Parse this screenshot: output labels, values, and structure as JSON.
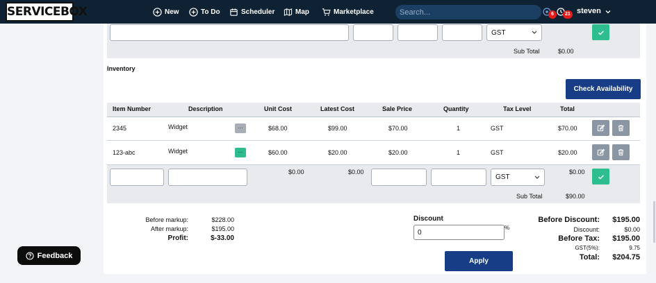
{
  "header": {
    "logo_text": "SERVICEBOX",
    "nav": [
      {
        "label": "New",
        "icon": "plus-circle-icon"
      },
      {
        "label": "To Do",
        "icon": "plus-circle-icon"
      },
      {
        "label": "Scheduler",
        "icon": "calendar-icon"
      },
      {
        "label": "Map",
        "icon": "map-icon"
      },
      {
        "label": "Marketplace",
        "icon": "cart-icon"
      }
    ],
    "search_placeholder": "Search...",
    "notification_badge": "6",
    "clock_badge": "21",
    "username": "steven"
  },
  "top_section": {
    "tax_selected": "GST",
    "subtotal_label": "Sub Total",
    "subtotal_value": "$0.00"
  },
  "inventory": {
    "title": "Inventory",
    "check_availability_label": "Check Availability",
    "columns": [
      "Item Number",
      "Description",
      "Unit Cost",
      "Latest Cost",
      "Sale Price",
      "Quantity",
      "Tax Level",
      "Total"
    ],
    "rows": [
      {
        "item_number": "2345",
        "description": "Widget",
        "dots": "...",
        "unit_cost": "$68.00",
        "latest_cost": "$99.00",
        "sale_price": "$70.00",
        "quantity": "1",
        "tax_level": "GST",
        "total": "$70.00"
      },
      {
        "item_number": "123-abc",
        "description": "Widget",
        "dots": "...",
        "unit_cost": "$60.00",
        "latest_cost": "$20.00",
        "sale_price": "$20.00",
        "quantity": "1",
        "tax_level": "GST",
        "total": "$20.00"
      }
    ],
    "new_row": {
      "unit_cost": "$0.00",
      "latest_cost": "$0.00",
      "tax_selected": "GST",
      "total": "$0.00"
    },
    "subtotal_label": "Sub Total",
    "subtotal_value": "$90.00"
  },
  "markup": {
    "before_markup_label": "Before markup:",
    "before_markup_value": "$228.00",
    "after_markup_label": "After markup:",
    "after_markup_value": "$195.00",
    "profit_label": "Profit:",
    "profit_value": "$-33.00"
  },
  "discount": {
    "label": "Discount",
    "value": "0",
    "unit": "%",
    "apply_label": "Apply"
  },
  "totals": {
    "before_discount_label": "Before Discount:",
    "before_discount_value": "$195.00",
    "discount_label": "Discount:",
    "discount_value": "$0.00",
    "before_tax_label": "Before Tax:",
    "before_tax_value": "$195.00",
    "gst_label": "GST(5%):",
    "gst_value": "9.75",
    "total_label": "Total:",
    "total_value": "$204.75"
  },
  "feedback_label": "Feedback",
  "colors": {
    "topbar": "#0f2233",
    "primary_button": "#163d85",
    "success_button": "#2dbd8f",
    "badge": "#e21b1b"
  }
}
